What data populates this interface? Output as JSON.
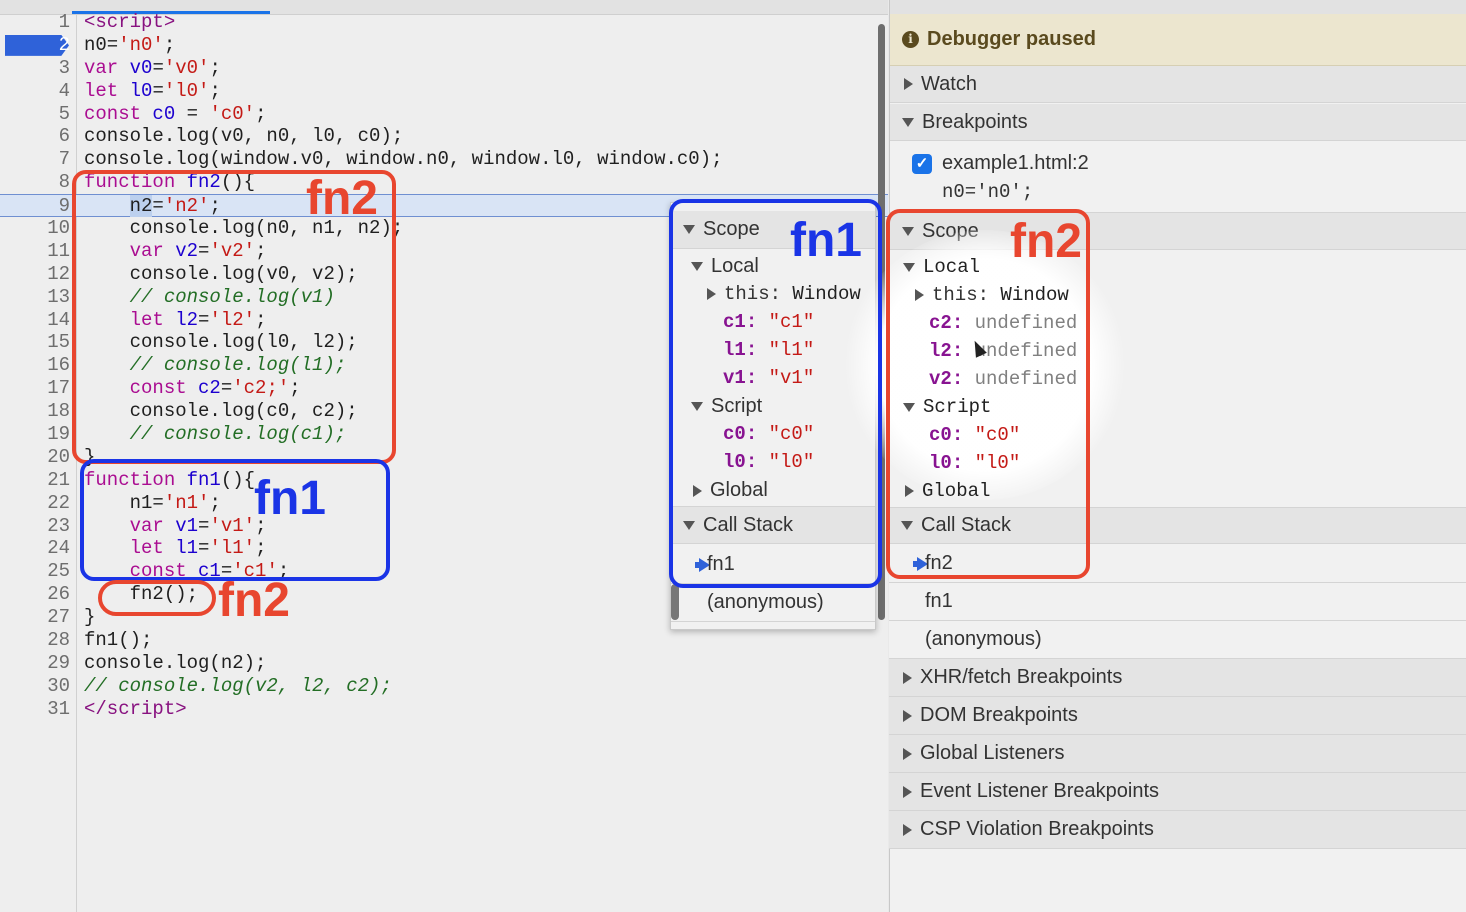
{
  "editor": {
    "lines": [
      {
        "n": "1",
        "h": "<span class=\"tag\">&lt;script&gt;</span>"
      },
      {
        "n": "2",
        "h": "n0=<span class=\"s\">'n0'</span>;",
        "current": true
      },
      {
        "n": "3",
        "h": "<span class=\"k\">var</span> <span class=\"v\">v0</span>=<span class=\"s\">'v0'</span>;"
      },
      {
        "n": "4",
        "h": "<span class=\"k\">let</span> <span class=\"v\">l0</span>=<span class=\"s\">'l0'</span>;"
      },
      {
        "n": "5",
        "h": "<span class=\"k\">const</span> <span class=\"v\">c0</span> = <span class=\"s\">'c0'</span>;"
      },
      {
        "n": "6",
        "h": "console.log(v0, n0, l0, c0);"
      },
      {
        "n": "7",
        "h": "console.log(window.v0, window.n0, window.l0, window.c0);"
      },
      {
        "n": "8",
        "h": "<span class=\"k\">function</span> <span class=\"v\">fn2</span>(){"
      },
      {
        "n": "9",
        "h": "    <span class=\"sel\">n2</span>=<span class=\"s\">'n2'</span>;",
        "exec": true
      },
      {
        "n": "10",
        "h": "    console.log(n0, n1, n2);"
      },
      {
        "n": "11",
        "h": "    <span class=\"k\">var</span> <span class=\"v\">v2</span>=<span class=\"s\">'v2'</span>;"
      },
      {
        "n": "12",
        "h": "    console.log(v0, v2);"
      },
      {
        "n": "13",
        "h": "    <span class=\"c\">// console.log(v1)</span>"
      },
      {
        "n": "14",
        "h": "    <span class=\"k\">let</span> <span class=\"v\">l2</span>=<span class=\"s\">'l2'</span>;"
      },
      {
        "n": "15",
        "h": "    console.log(l0, l2);"
      },
      {
        "n": "16",
        "h": "    <span class=\"c\">// console.log(l1);</span>"
      },
      {
        "n": "17",
        "h": "    <span class=\"k\">const</span> <span class=\"v\">c2</span>=<span class=\"s\">'c2;'</span>;"
      },
      {
        "n": "18",
        "h": "    console.log(c0, c2);"
      },
      {
        "n": "19",
        "h": "    <span class=\"c\">// console.log(c1);</span>"
      },
      {
        "n": "20",
        "h": "}"
      },
      {
        "n": "21",
        "h": "<span class=\"k\">function</span> <span class=\"v\">fn1</span>(){"
      },
      {
        "n": "22",
        "h": "    n1=<span class=\"s\">'n1'</span>;"
      },
      {
        "n": "23",
        "h": "    <span class=\"k\">var</span> <span class=\"v\">v1</span>=<span class=\"s\">'v1'</span>;"
      },
      {
        "n": "24",
        "h": "    <span class=\"k\">let</span> <span class=\"v\">l1</span>=<span class=\"s\">'l1'</span>;"
      },
      {
        "n": "25",
        "h": "    <span class=\"k\">const</span> <span class=\"v\">c1</span>=<span class=\"s\">'c1'</span>;"
      },
      {
        "n": "26",
        "h": "    fn2();"
      },
      {
        "n": "27",
        "h": "}"
      },
      {
        "n": "28",
        "h": "fn1();"
      },
      {
        "n": "29",
        "h": "console.log(n2);"
      },
      {
        "n": "30",
        "h": "<span class=\"c\">// console.log(v2, l2, c2);</span>"
      },
      {
        "n": "31",
        "h": "<span class=\"tag\">&lt;/script&gt;</span>"
      }
    ]
  },
  "popover": {
    "scope_label": "Scope",
    "local_label": "Local",
    "this_key": "this",
    "this_value": "Window",
    "local_vars": [
      {
        "k": "c1",
        "v": "\"c1\""
      },
      {
        "k": "l1",
        "v": "\"l1\""
      },
      {
        "k": "v1",
        "v": "\"v1\""
      }
    ],
    "script_label": "Script",
    "script_vars": [
      {
        "k": "c0",
        "v": "\"c0\""
      },
      {
        "k": "l0",
        "v": "\"l0\""
      }
    ],
    "global_label": "Global",
    "callstack_label": "Call Stack",
    "frames": [
      "fn1",
      "(anonymous)"
    ]
  },
  "sidebar": {
    "paused_text": "Debugger paused",
    "watch_label": "Watch",
    "breakpoints_label": "Breakpoints",
    "breakpoint_file": "example1.html:2",
    "breakpoint_code": "n0='n0';",
    "scope_label": "Scope",
    "local_label": "Local",
    "this_key": "this",
    "this_value": "Window",
    "local_vars": [
      {
        "k": "c2",
        "v": "undefined"
      },
      {
        "k": "l2",
        "v": "undefined"
      },
      {
        "k": "v2",
        "v": "undefined"
      }
    ],
    "script_label": "Script",
    "script_vars": [
      {
        "k": "c0",
        "v": "\"c0\""
      },
      {
        "k": "l0",
        "v": "\"l0\""
      }
    ],
    "global_label": "Global",
    "callstack_label": "Call Stack",
    "frames": [
      "fn2",
      "fn1",
      "(anonymous)"
    ],
    "more_sections": [
      "XHR/fetch Breakpoints",
      "DOM Breakpoints",
      "Global Listeners",
      "Event Listener Breakpoints",
      "CSP Violation Breakpoints"
    ]
  },
  "annotations": {
    "fn2_code": "fn2",
    "fn1_code": "fn1",
    "fn2_call": "fn2",
    "fn1_popover": "fn1",
    "fn2_sidebar": "fn2"
  },
  "colors": {
    "annotation_red": "#e8462f",
    "annotation_blue": "#1a34e6",
    "breakpoint_blue": "#2f62d9"
  }
}
